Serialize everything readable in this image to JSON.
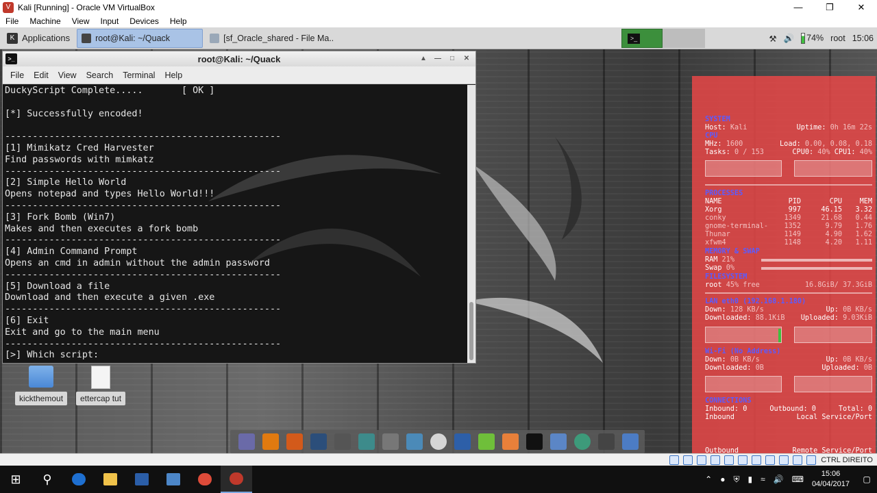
{
  "vbox": {
    "title": "Kali [Running] - Oracle VM VirtualBox",
    "menu": [
      "File",
      "Machine",
      "View",
      "Input",
      "Devices",
      "Help"
    ],
    "status_host_key": "CTRL DIREITO"
  },
  "xfce_panel": {
    "applications_label": "Applications",
    "tasks": [
      {
        "label": "root@Kali: ~/Quack",
        "active": true
      },
      {
        "label": "[sf_Oracle_shared - File Ma...",
        "active": false
      }
    ],
    "battery_percent": "74%",
    "user": "root",
    "time": "15:06"
  },
  "terminal": {
    "title": "root@Kali: ~/Quack",
    "menu": [
      "File",
      "Edit",
      "View",
      "Search",
      "Terminal",
      "Help"
    ],
    "lines": [
      "DuckyScript Complete.....       [ OK ]",
      "",
      "[*] Successfully encoded!",
      "",
      "--------------------------------------------------",
      "[1] Mimikatz Cred Harvester",
      "Find passwords with mimkatz",
      "--------------------------------------------------",
      "[2] Simple Hello World",
      "Opens notepad and types Hello World!!!",
      "--------------------------------------------------",
      "[3] Fork Bomb (Win7)",
      "Makes and then executes a fork bomb",
      "--------------------------------------------------",
      "[4] Admin Command Prompt",
      "Opens an cmd in admin without the admin password",
      "--------------------------------------------------",
      "[5] Download a file",
      "Download and then execute a given .exe",
      "--------------------------------------------------",
      "[6] Exit",
      "Exit and go to the main menu",
      "--------------------------------------------------",
      "[>] Which script: "
    ]
  },
  "desktop_icons": [
    {
      "label": "kickthemout",
      "type": "folder"
    },
    {
      "label": "ettercap tut",
      "type": "file"
    }
  ],
  "conky": {
    "system_header": "SYSTEM",
    "host_label": "Host:",
    "host": "Kali",
    "uptime_label": "Uptime:",
    "uptime": "0h 16m 22s",
    "cpu_header": "CPU",
    "mhz_label": "MHz:",
    "mhz": "1600",
    "load_label": "Load:",
    "load": "0.00, 0.08, 0.18",
    "tasks_label": "Tasks:",
    "tasks": "0 / 153",
    "cpu0_label": "CPU0:",
    "cpu0": "40%",
    "cpu1_label": "CPU1:",
    "cpu1": "40%",
    "processes_header": "PROCESSES",
    "proc_cols": [
      "NAME",
      "PID",
      "CPU",
      "MEM"
    ],
    "processes": [
      {
        "name": "Xorg",
        "pid": "997",
        "cpu": "46.15",
        "mem": "3.32"
      },
      {
        "name": "conky",
        "pid": "1349",
        "cpu": "21.68",
        "mem": "0.44"
      },
      {
        "name": "gnome-terminal-",
        "pid": "1352",
        "cpu": "9.79",
        "mem": "1.76"
      },
      {
        "name": "Thunar",
        "pid": "1149",
        "cpu": "4.90",
        "mem": "1.62"
      },
      {
        "name": "xfwm4",
        "pid": "1148",
        "cpu": "4.20",
        "mem": "1.11"
      }
    ],
    "memory_header": "MEMORY & SWAP",
    "ram_label": "RAM",
    "ram_value": "21%",
    "swap_label": "Swap",
    "swap_value": "0%",
    "fs_header": "FILESYSTEM",
    "fs_root_label": "root",
    "fs_root_free": "45% free",
    "fs_root_size": "16.8GiB/ 37.3GiB",
    "lan_header": "LAN eth0 (192.168.1.180)",
    "lan_down_label": "Down:",
    "lan_down": "128   KB/s",
    "lan_up_label": "Up:",
    "lan_up": "0B    KB/s",
    "lan_downloaded_label": "Downloaded:",
    "lan_downloaded": "88.1KiB",
    "lan_uploaded_label": "Uploaded:",
    "lan_uploaded": "9.03KiB",
    "wifi_header": "Wi-Fi (No Address)",
    "wifi_down_label": "Down:",
    "wifi_down": "0B    KB/s",
    "wifi_up_label": "Up:",
    "wifi_up": "0B    KB/s",
    "wifi_downloaded_label": "Downloaded:",
    "wifi_downloaded": "0B",
    "wifi_uploaded_label": "Uploaded:",
    "wifi_uploaded": "0B",
    "connections_header": "CONNECTIONS",
    "inbound_label": "Inbound:",
    "inbound": "0",
    "outbound_label": "Outbound:",
    "outbound": "0",
    "total_label": "Total:",
    "total": "0",
    "inbound_col": "Inbound",
    "local_col": "Local Service/Port",
    "outbound_col": "Outbound",
    "remote_col": "Remote Service/Port"
  },
  "windows_taskbar": {
    "time": "15:06",
    "date": "04/04/2017"
  },
  "colors": {
    "conky_bg": "#e84646",
    "conky_header": "#5b5bff",
    "terminal_bg": "#161616",
    "panel_bg": "#d9d9d9",
    "active_task": "#a9c3e6",
    "workspace_active": "#3c8f3c"
  },
  "icons": {
    "dock": [
      "mail-icon",
      "sublime-icon",
      "burp-icon",
      "kali-icon",
      "spider-icon",
      "app-icon",
      "maltego-icon",
      "eye-icon",
      "beef-icon",
      "metasploit-icon",
      "notes-icon",
      "cherrytree-icon",
      "terminal-icon",
      "files-icon",
      "browser-icon",
      "search-icon",
      "folder-icon"
    ]
  }
}
